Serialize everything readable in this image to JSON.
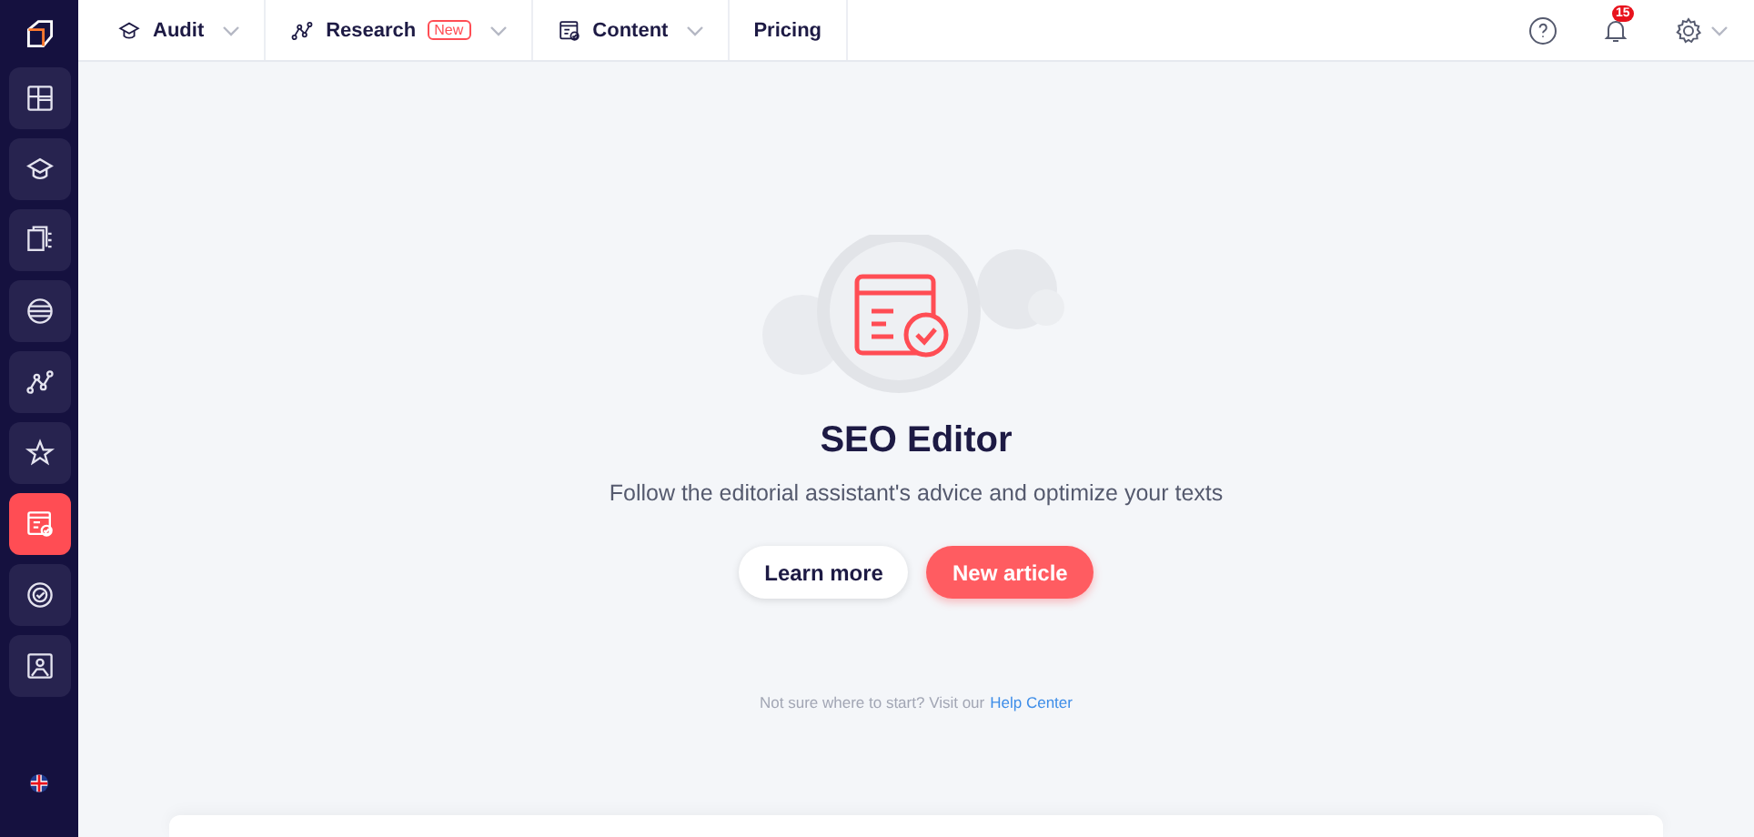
{
  "sidebar": {
    "items": [
      {
        "selected": false
      },
      {
        "selected": false
      },
      {
        "selected": false
      },
      {
        "selected": false
      },
      {
        "selected": false
      },
      {
        "selected": false
      },
      {
        "selected": true
      },
      {
        "selected": false
      },
      {
        "selected": false
      }
    ]
  },
  "topbar": {
    "menu": [
      {
        "label": "Audit",
        "dropdown": true
      },
      {
        "label": "Research",
        "badge": "New",
        "dropdown": true
      },
      {
        "label": "Content",
        "dropdown": true
      },
      {
        "label": "Pricing",
        "dropdown": false
      }
    ],
    "notifications": "15"
  },
  "hero": {
    "title": "SEO Editor",
    "subtitle": "Follow the editorial assistant's advice and optimize your texts",
    "buttons": [
      {
        "label": "Learn more",
        "kind": "secondary"
      },
      {
        "label": "New article",
        "kind": "primary"
      }
    ],
    "help_text": "Not sure where to start? Visit our",
    "help_link": "Help Center"
  }
}
